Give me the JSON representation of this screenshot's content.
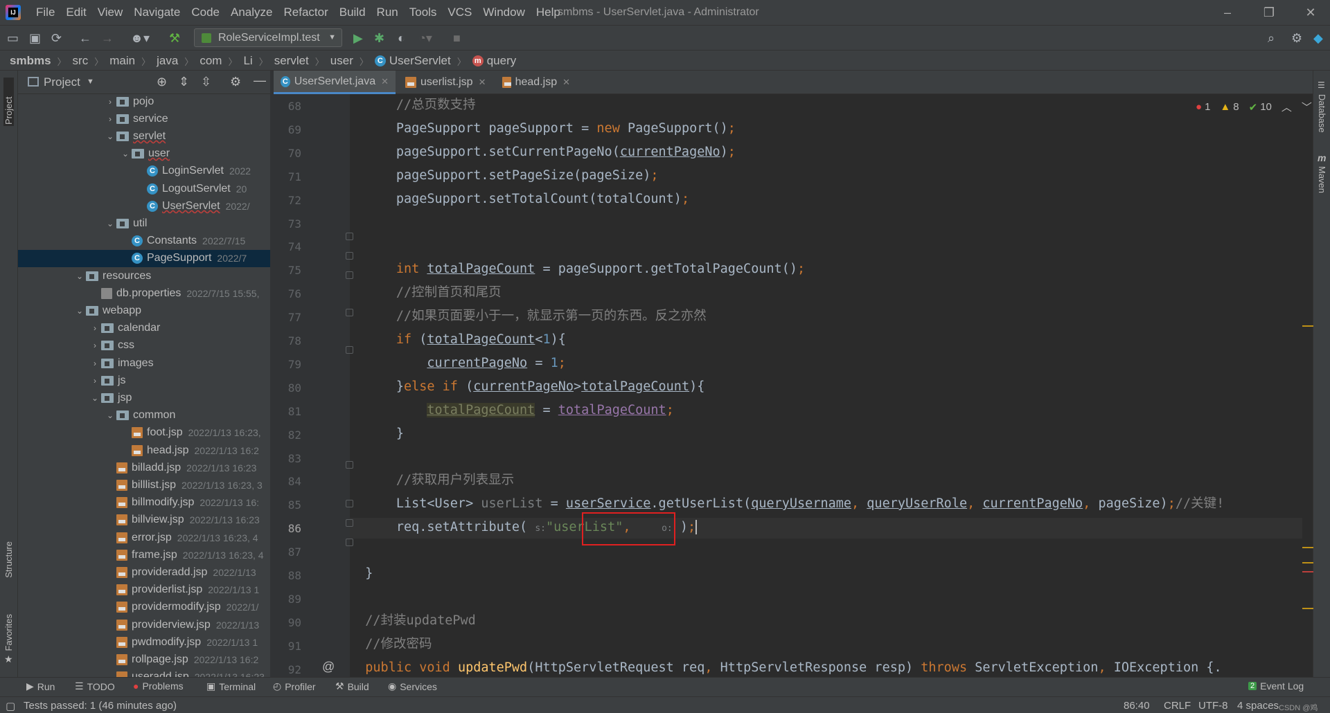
{
  "app": {
    "logo_text": "IJ",
    "window_title": "smbms - UserServlet.java - Administrator",
    "menu": [
      "File",
      "Edit",
      "View",
      "Navigate",
      "Code",
      "Analyze",
      "Refactor",
      "Build",
      "Run",
      "Tools",
      "VCS",
      "Window",
      "Help"
    ],
    "window_controls": {
      "minimize": "–",
      "restore": "❐",
      "close": "✕"
    }
  },
  "toolbar": {
    "run_config": "RoleServiceImpl.test"
  },
  "breadcrumbs": [
    "smbms",
    "src",
    "main",
    "java",
    "com",
    "Li",
    "servlet",
    "user",
    "UserServlet",
    "query"
  ],
  "project_panel": {
    "title": "Project",
    "items": [
      {
        "name": "pojo",
        "date": ""
      },
      {
        "name": "service",
        "date": ""
      },
      {
        "name": "servlet",
        "date": ""
      },
      {
        "name": "user",
        "date": ""
      },
      {
        "name": "LoginServlet",
        "date": "2022"
      },
      {
        "name": "LogoutServlet",
        "date": "20"
      },
      {
        "name": "UserServlet",
        "date": "2022/"
      },
      {
        "name": "util",
        "date": ""
      },
      {
        "name": "Constants",
        "date": "2022/7/15"
      },
      {
        "name": "PageSupport",
        "date": "2022/7"
      },
      {
        "name": "resources",
        "date": ""
      },
      {
        "name": "db.properties",
        "date": "2022/7/15 15:55,"
      },
      {
        "name": "webapp",
        "date": ""
      },
      {
        "name": "calendar",
        "date": ""
      },
      {
        "name": "css",
        "date": ""
      },
      {
        "name": "images",
        "date": ""
      },
      {
        "name": "js",
        "date": ""
      },
      {
        "name": "jsp",
        "date": ""
      },
      {
        "name": "common",
        "date": ""
      },
      {
        "name": "foot.jsp",
        "date": "2022/1/13 16:23,"
      },
      {
        "name": "head.jsp",
        "date": "2022/1/13 16:2"
      },
      {
        "name": "billadd.jsp",
        "date": "2022/1/13 16:23"
      },
      {
        "name": "billlist.jsp",
        "date": "2022/1/13 16:23, 3"
      },
      {
        "name": "billmodify.jsp",
        "date": "2022/1/13 16:"
      },
      {
        "name": "billview.jsp",
        "date": "2022/1/13 16:23"
      },
      {
        "name": "error.jsp",
        "date": "2022/1/13 16:23, 4"
      },
      {
        "name": "frame.jsp",
        "date": "2022/1/13 16:23, 4"
      },
      {
        "name": "provideradd.jsp",
        "date": "2022/1/13"
      },
      {
        "name": "providerlist.jsp",
        "date": "2022/1/13 1"
      },
      {
        "name": "providermodify.jsp",
        "date": "2022/1/"
      },
      {
        "name": "providerview.jsp",
        "date": "2022/1/13"
      },
      {
        "name": "pwdmodify.jsp",
        "date": "2022/1/13 1"
      },
      {
        "name": "rollpage.jsp",
        "date": "2022/1/13 16:2"
      },
      {
        "name": "useradd.jsp",
        "date": "2022/1/13 16:23"
      }
    ]
  },
  "tabs": [
    {
      "label": "UserServlet.java",
      "active": true
    },
    {
      "label": "userlist.jsp",
      "active": false
    },
    {
      "label": "head.jsp",
      "active": false
    }
  ],
  "inspections": {
    "errors": "1",
    "warnings": "8",
    "ok": "10"
  },
  "editor": {
    "line_numbers": [
      "68",
      "69",
      "70",
      "71",
      "72",
      "73",
      "74",
      "75",
      "76",
      "77",
      "78",
      "79",
      "80",
      "81",
      "82",
      "83",
      "84",
      "85",
      "86",
      "87",
      "88",
      "89",
      "90",
      "91",
      "92"
    ],
    "current_line": "86",
    "hint_s": "s:",
    "hint_o": "o:"
  },
  "left_strip": {
    "project": "Project",
    "structure": "Structure",
    "favorites": "Favorites"
  },
  "right_strip": {
    "database": "Database",
    "maven": "Maven"
  },
  "bottom_tools": [
    "Run",
    "TODO",
    "Problems",
    "Terminal",
    "Profiler",
    "Build",
    "Services"
  ],
  "event_log": "Event Log",
  "status": {
    "message": "Tests passed: 1 (46 minutes ago)",
    "position": "86:40",
    "line_sep": "CRLF",
    "encoding": "UTF-8",
    "indent": "4 spaces",
    "watermark": "CSDN @鸡"
  }
}
